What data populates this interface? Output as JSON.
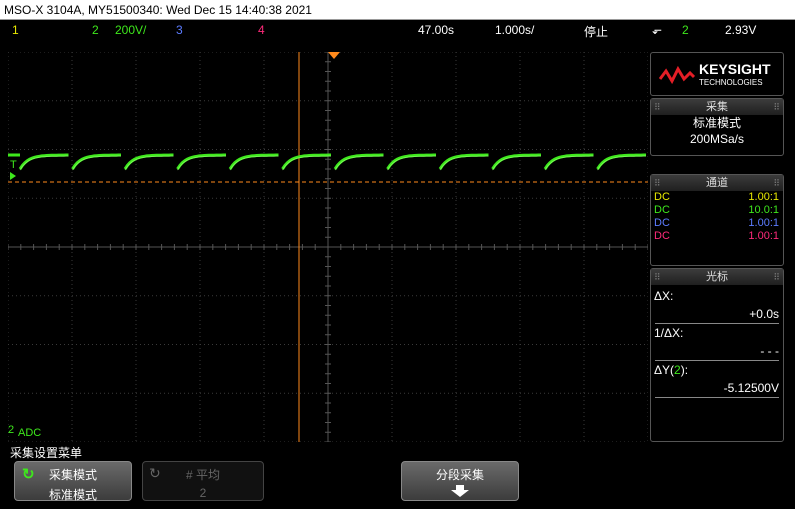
{
  "title_bar": {
    "text": "MSO-X 3104A, MY51500340: Wed Dec 15 14:40:38 2021"
  },
  "channel_bar": {
    "ch1": "1",
    "ch2": "2",
    "ch2_scale": "200V/",
    "ch3": "3",
    "ch4": "4",
    "time_position": "47.00s",
    "time_scale": "1.000s/",
    "run_state": "停止",
    "trigger_edge": "⬐",
    "trigger_channel": "2",
    "trigger_level": "2.93V"
  },
  "colors": {
    "ch1": "#e8e800",
    "ch2": "#3ee81c",
    "ch3": "#5c7cff",
    "ch4": "#ff2a7a",
    "cursor": "#ff8a1c"
  },
  "waveform": {
    "trigger_marker": "T",
    "ground_marker": "2",
    "acq_label": "ADC"
  },
  "brand": {
    "name": "KEYSIGHT",
    "sub": "TECHNOLOGIES"
  },
  "acquire_panel": {
    "header": "采集",
    "mode": "标准模式",
    "rate": "200MSa/s"
  },
  "channel_panel": {
    "header": "通道",
    "rows": [
      {
        "coupling": "DC",
        "probe": "1.00:1"
      },
      {
        "coupling": "DC",
        "probe": "10.0:1"
      },
      {
        "coupling": "DC",
        "probe": "1.00:1"
      },
      {
        "coupling": "DC",
        "probe": "1.00:1"
      }
    ]
  },
  "cursor_panel": {
    "header": "光标",
    "dx_label": "ΔX:",
    "dx_value": "+0.0s",
    "inv_label": "1/ΔX:",
    "inv_value": "- - -",
    "dy_label_pre": "ΔY(",
    "dy_label_ch": "2",
    "dy_label_post": "):",
    "dy_value": "-5.12500V"
  },
  "softkeys": {
    "menu_title": "采集设置菜单",
    "mode_top": "采集模式",
    "mode_bottom": "标准模式",
    "avg_top": "# 平均",
    "avg_bottom": "2",
    "seg_top": "分段采集"
  }
}
